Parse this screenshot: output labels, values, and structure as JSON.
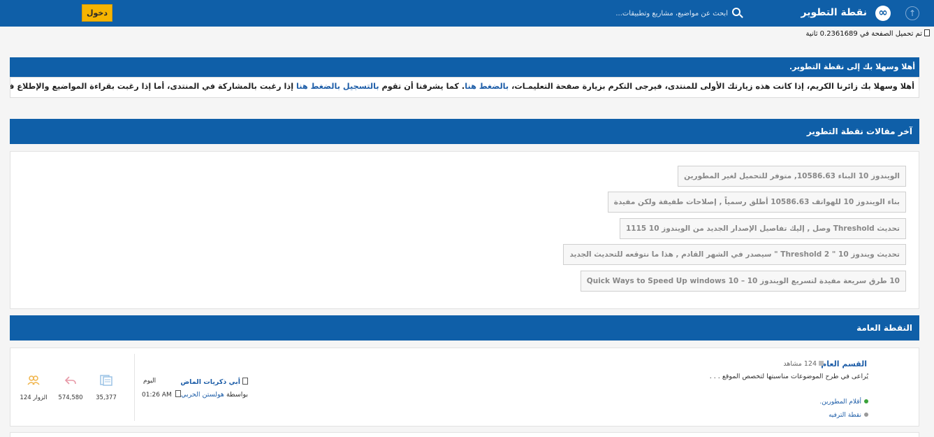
{
  "header": {
    "logo_text": "نقطة التطوير",
    "search_placeholder": "أبحث عن مواضيع، مشاريع وتطبيقات...",
    "login_label": "دخول"
  },
  "load_time": "تم تحميل الصفحة في 0.2361689 ثانية",
  "welcome": {
    "title": "أهلا وسهلا بك إلى نقطة التطوير.",
    "text_1": "أهلا وسهلا بك زائرنا الكريم، إذا كانت هذه زيارتك الأولى للمنتدى، فيرجى التكرم بزيارة صفحة التعليمـات،",
    "link_1": "بالضغط هنا",
    "text_2": ". كما يشرفنا أن تقوم",
    "link_2": "بالتسجيل بالضغط هنا",
    "text_3": "إذا رغبت بالمشاركة في المنتدى، أما إذا رغبت بقراءة المواضيع والإطلاع فتفضل بزيارة القسم الذي ترغب أدناه."
  },
  "articles": {
    "title": "آخر مقالات نقطة التطوير",
    "items": [
      "الويندوز 10 البناء 10586.63, متوفر للتحميل لغير المطورين",
      "بناء الويندوز 10 للهواتف 10586.63 أطلق رسمياً , إصلاحات طفيفة ولكن مفيدة",
      "تحديث Threshold وصل , إليك تفاصيل الإصدار الجديد من الويندوز 10 1115",
      "تحديث ويندوز 10 \" Threshold 2 \" سيصدر في الشهر القادم , هذا ما نتوقعه للتحديث الجديد",
      "10 طرق سريعة مفيدة لتسريع الويندوز 10 – Quick Ways to Speed Up windows 10"
    ]
  },
  "general": {
    "title": "النقطة العامة",
    "forum": {
      "title": "القسم العام",
      "views": "124 مشاهد",
      "description": "يُراعى في طرح الموضوعات مناسبتها لتخصص الموقع . . .",
      "subforums": [
        "أقلام المطورين.",
        "نقطة الترفيه"
      ],
      "last_post": {
        "title": "أبي ذكريات الماض",
        "by_prefix": "بواسطة",
        "author": "هولستن الحربي",
        "day": "اليوم",
        "time": "01:26 AM"
      },
      "stats": {
        "threads": "35,377",
        "posts": "574,580",
        "visitors": "الزوار 124"
      }
    }
  },
  "colors": {
    "primary": "#0f5fa8",
    "login_button": "#f5b400",
    "link": "#1e5ea8"
  }
}
